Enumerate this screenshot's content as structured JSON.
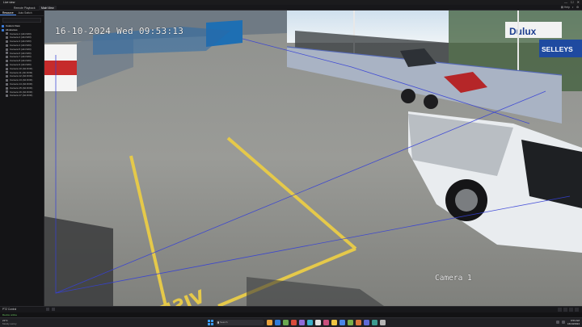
{
  "window": {
    "app_title": "Live view",
    "controls": [
      "—",
      "☐",
      "✕"
    ]
  },
  "tabs": [
    {
      "label": "Remote Playback"
    },
    {
      "label": "Main View"
    }
  ],
  "tabbar_right": [
    "▤ Help",
    "◐",
    "⚙"
  ],
  "sidebar": {
    "tabs": [
      "Resource",
      "Auto Switch"
    ],
    "items": [
      {
        "label": "Custom View",
        "type": "group"
      },
      {
        "label": "All-devices",
        "type": "group"
      },
      {
        "label": "Camera 1 (All-NVR)",
        "type": "cam"
      },
      {
        "label": "Camera 2 (All-NVR)",
        "type": "cam"
      },
      {
        "label": "Camera 3 (All-NVR)",
        "type": "cam"
      },
      {
        "label": "Camera 4 (All-NVR)",
        "type": "cam"
      },
      {
        "label": "Camera 5 (All-NVR)",
        "type": "cam"
      },
      {
        "label": "Camera 6 (All-NVR)",
        "type": "cam"
      },
      {
        "label": "Camera 7 (All-NVR)",
        "type": "cam"
      },
      {
        "label": "Camera 8 (All-NVR)",
        "type": "cam"
      },
      {
        "label": "Camera 9 (All-NVR)",
        "type": "cam"
      },
      {
        "label": "Camera 10 (All-NVR)",
        "type": "cam"
      },
      {
        "label": "Camera 11 (All-NVR)",
        "type": "cam"
      },
      {
        "label": "Camera 12 (All-NVR)",
        "type": "cam"
      },
      {
        "label": "Camera 13 (All-NVR)",
        "type": "cam"
      },
      {
        "label": "Camera 14 (All-NVR)",
        "type": "cam"
      },
      {
        "label": "Camera 15 (All-NVR)",
        "type": "cam"
      },
      {
        "label": "Camera 16 (All-NVR)",
        "type": "cam"
      },
      {
        "label": "Camera 17 (All-NVR)",
        "type": "cam"
      }
    ]
  },
  "video": {
    "osd_timestamp": "16-10-2024 Wed 09:53:13",
    "camera_label": "Camera 1",
    "scene_signs": {
      "sign1": "Dulux",
      "sign2": "SELLEYS",
      "floor_text": "VISITORS"
    }
  },
  "status": {
    "label": "PTZ Control"
  },
  "info": {
    "text": "Device online"
  },
  "taskbar": {
    "weather_temp": "21°C",
    "weather_desc": "Mostly sunny",
    "search_placeholder": "Search",
    "time": "9:53 AM",
    "date": "16/10/2024",
    "app_colors": [
      "#e8a33c",
      "#2f7cd9",
      "#6aa84f",
      "#d94c3b",
      "#8e6bd8",
      "#3bb0c9",
      "#e0e0e0",
      "#c94f7c",
      "#f0c541",
      "#4a86e8",
      "#79b04a",
      "#d9763b",
      "#5f6ad6",
      "#3c9b8f",
      "#b5b5b5"
    ]
  }
}
